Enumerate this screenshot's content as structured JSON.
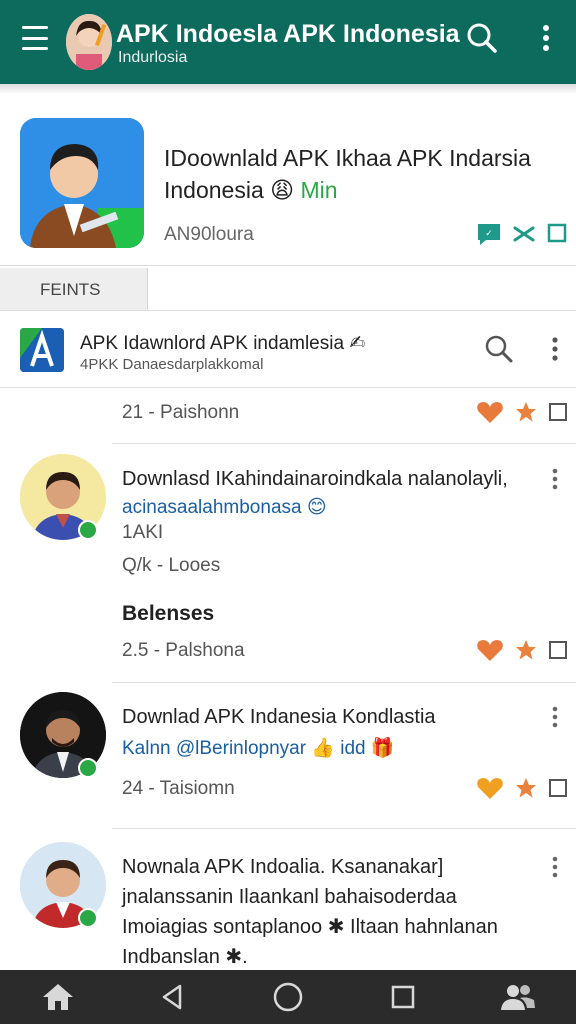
{
  "appbar": {
    "title": "APK Indoesla APK Indonesia",
    "subtitle": "Indurlosia"
  },
  "hero": {
    "name_part1": "IDoownlald APK Ikhaa APK Indarsia Indonesia",
    "name_emoji": "😩",
    "name_part2": "Min",
    "developer": "AN90loura"
  },
  "section_tab": "FEINTS",
  "header_item": {
    "title": "APK Idawnlord APK indamlesia",
    "subtitle": "4PKK Danaesdarplakkomal"
  },
  "first_meta": "21 - Paishonn",
  "posts": [
    {
      "title": "Downlasd IKahindainaroindkala nalanolayli,",
      "line": "acinasaalahmbonasa 😊",
      "count": "1AKI",
      "meta": "Q/k - Looes",
      "section_label": "Belenses",
      "meta2": "2.5 - Palshona"
    },
    {
      "title": "Downlad APK Indanesia Kondlastia",
      "line": "Kalnn @lBerinlopnyar 👍 idd 🎁",
      "meta": "24 - Taisiomn"
    },
    {
      "title": "Nownala APK Indoalia. Ksananakar]",
      "text": "jnalanssanin Ilaankanl bahaisoderdaa Imoiagias sontaplanoo ✱ Iltaan hahnlanan Indbanslan ✱."
    }
  ],
  "colors": {
    "appbar": "#0d6b5e",
    "accent_green": "#2aa845",
    "link_blue": "#1a5fa0",
    "heart_orange": "#e87a3c",
    "star_orange": "#e8823c",
    "nav_bar": "#2b2b2b"
  }
}
